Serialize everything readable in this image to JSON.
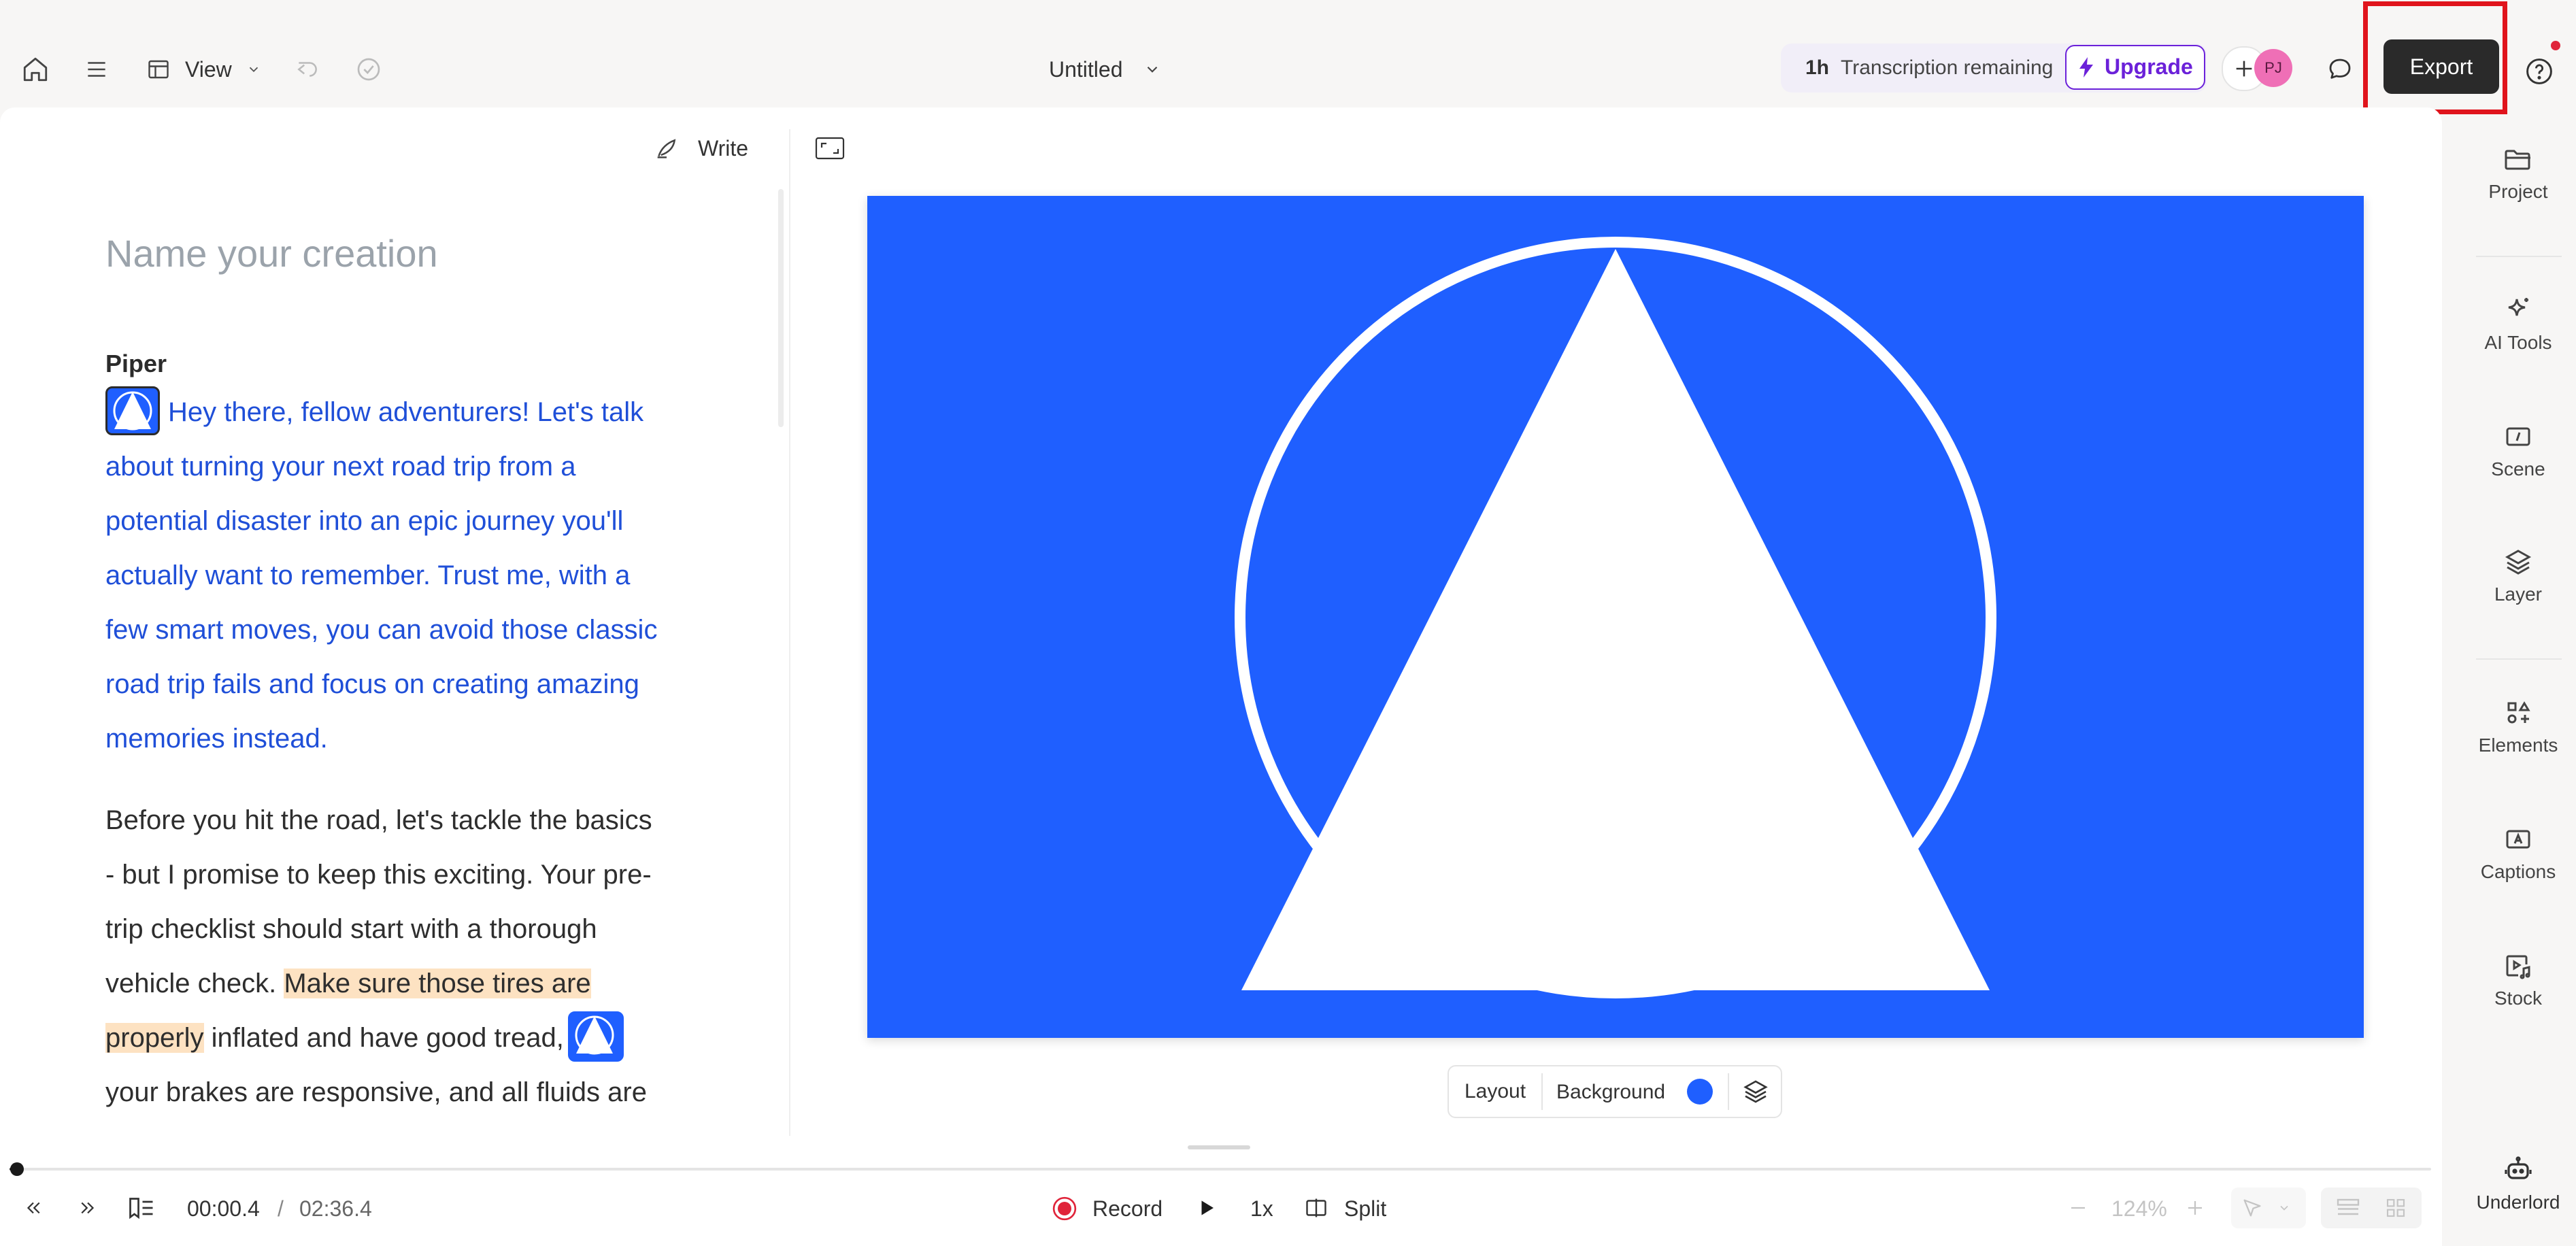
{
  "topbar": {
    "view_label": "View",
    "doc_title": "Untitled",
    "transcription_amount": "1h",
    "transcription_text": "Transcription remaining",
    "upgrade_label": "Upgrade",
    "avatar_initials": "PJ",
    "export_label": "Export"
  },
  "editor": {
    "write_label": "Write",
    "title_placeholder": "Name your creation",
    "speaker": "Piper",
    "paragraph1_lines": [
      "Hey there, fellow adventurers! Let's talk",
      "about turning your next road trip from a",
      "potential disaster into an epic journey you'll",
      "actually want to remember. Trust me, with a",
      "few smart moves, you can avoid those classic",
      "road trip fails and focus on creating amazing",
      "memories instead."
    ],
    "paragraph2": {
      "line1": "Before you hit the road, let's tackle the basics",
      "line2": "- but I promise to keep this exciting. Your pre-",
      "line3": "trip checklist should start with a thorough",
      "line4_plain": "vehicle check. ",
      "line4_highlight": "Make sure those tires are",
      "line5_highlight": "properly",
      "line5_plain": " inflated and have good tread,",
      "line6": "your brakes are responsive, and all fluids are"
    }
  },
  "canvas": {
    "background_color": "#1f5fff",
    "layout_label": "Layout",
    "background_label": "Background"
  },
  "sidebar": {
    "items": [
      {
        "label": "Project",
        "icon": "folder-icon"
      },
      {
        "label": "AI Tools",
        "icon": "sparkle-icon"
      },
      {
        "label": "Scene",
        "icon": "scene-icon"
      },
      {
        "label": "Layer",
        "icon": "layers-icon"
      },
      {
        "label": "Elements",
        "icon": "elements-icon"
      },
      {
        "label": "Captions",
        "icon": "captions-icon"
      },
      {
        "label": "Stock",
        "icon": "stock-icon"
      },
      {
        "label": "Underlord",
        "icon": "robot-icon"
      }
    ]
  },
  "bottombar": {
    "current_time": "00:00.4",
    "separator": "/",
    "total_time": "02:36.4",
    "record_label": "Record",
    "speed_label": "1x",
    "split_label": "Split",
    "zoom_label": "124%",
    "playhead_progress": 0.003
  },
  "colors": {
    "accent_blue": "#1f5fff",
    "script_blue": "#1f4fd8",
    "upgrade_purple": "#6b21d9",
    "export_bg": "#2a2a2a",
    "highlight_box": "#e0141c",
    "record_red": "#e0243a"
  }
}
